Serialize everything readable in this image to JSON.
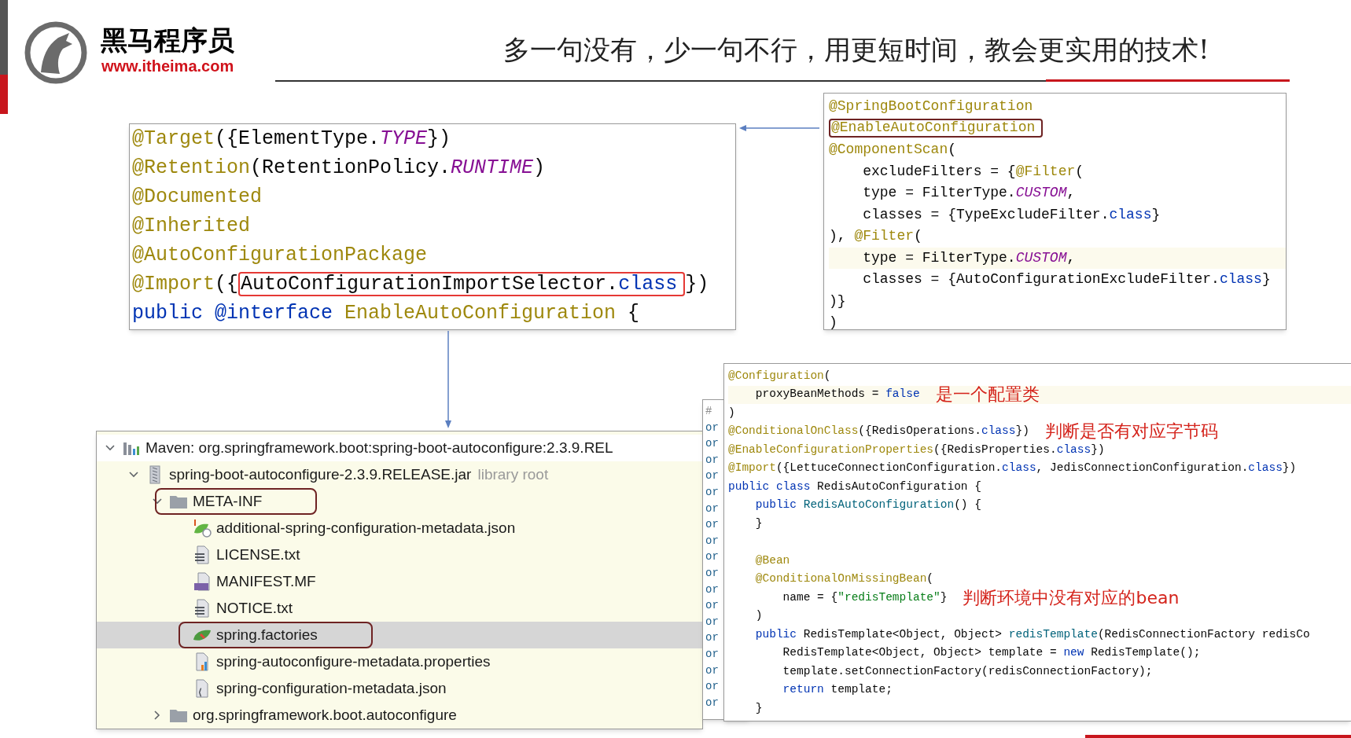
{
  "header": {
    "brand": "黑马程序员",
    "url": "www.itheima.com",
    "slogan": "多一句没有，少一句不行，用更短时间，教会更实用的技术!"
  },
  "annotation_source": {
    "lines": [
      {
        "tokens": [
          {
            "text": "@Target",
            "kind": "ann"
          },
          {
            "text": "({ElementType.",
            "kind": "p"
          },
          {
            "text": "TYPE",
            "kind": "const"
          },
          {
            "text": "})",
            "kind": "p"
          }
        ]
      },
      {
        "tokens": [
          {
            "text": "@Retention",
            "kind": "ann"
          },
          {
            "text": "(RetentionPolicy.",
            "kind": "p"
          },
          {
            "text": "RUNTIME",
            "kind": "const"
          },
          {
            "text": ")",
            "kind": "p"
          }
        ]
      },
      {
        "tokens": [
          {
            "text": "@Documented",
            "kind": "ann"
          }
        ]
      },
      {
        "tokens": [
          {
            "text": "@Inherited",
            "kind": "ann"
          }
        ]
      },
      {
        "tokens": [
          {
            "text": "@AutoConfigurationPackage",
            "kind": "ann"
          }
        ]
      },
      {
        "tokens": [
          {
            "text": "@Import",
            "kind": "ann"
          },
          {
            "text": "({",
            "kind": "p"
          },
          {
            "kind": "box",
            "color": "#e53935",
            "tokens": [
              {
                "text": "AutoConfigurationImportSelector.",
                "kind": "p"
              },
              {
                "text": "class",
                "kind": "kw"
              }
            ]
          },
          {
            "text": "})",
            "kind": "p"
          }
        ]
      },
      {
        "tokens": [
          {
            "text": "public @interface",
            "kind": "kw"
          },
          {
            "text": " EnableAutoConfiguration",
            "kind": "ann"
          },
          {
            "text": " {",
            "kind": "p"
          }
        ]
      }
    ]
  },
  "application_source": {
    "lines": [
      {
        "tokens": [
          {
            "text": "@SpringBootConfiguration",
            "kind": "ann"
          }
        ]
      },
      {
        "tokens": [
          {
            "kind": "box",
            "color": "#6e2323",
            "tokens": [
              {
                "text": "@EnableAutoConfiguration",
                "kind": "ann"
              }
            ]
          }
        ]
      },
      {
        "tokens": [
          {
            "text": "@ComponentScan",
            "kind": "ann"
          },
          {
            "text": "(",
            "kind": "p"
          }
        ]
      },
      {
        "tokens": [
          {
            "text": "    excludeFilters = {",
            "kind": "p"
          },
          {
            "text": "@Filter",
            "kind": "ann"
          },
          {
            "text": "(",
            "kind": "p"
          }
        ]
      },
      {
        "tokens": [
          {
            "text": "    type = FilterType.",
            "kind": "p"
          },
          {
            "text": "CUSTOM",
            "kind": "const"
          },
          {
            "text": ",",
            "kind": "p"
          }
        ]
      },
      {
        "tokens": [
          {
            "text": "    classes = {TypeExcludeFilter.",
            "kind": "p"
          },
          {
            "text": "class",
            "kind": "kw"
          },
          {
            "text": "}",
            "kind": "p"
          }
        ]
      },
      {
        "tokens": [
          {
            "text": "), ",
            "kind": "p"
          },
          {
            "text": "@Filter",
            "kind": "ann"
          },
          {
            "text": "(",
            "kind": "p"
          }
        ]
      },
      {
        "current": true,
        "tokens": [
          {
            "text": "    type = FilterType.",
            "kind": "p"
          },
          {
            "text": "CUSTOM",
            "kind": "const"
          },
          {
            "text": ",",
            "kind": "p"
          }
        ]
      },
      {
        "tokens": [
          {
            "text": "    classes = {AutoConfigurationExcludeFilter.",
            "kind": "p"
          },
          {
            "text": "class",
            "kind": "kw"
          },
          {
            "text": "}",
            "kind": "p"
          }
        ]
      },
      {
        "tokens": [
          {
            "text": ")}",
            "kind": "p"
          }
        ]
      },
      {
        "tokens": [
          {
            "text": ")",
            "kind": "p"
          }
        ]
      }
    ]
  },
  "project_tree": {
    "items": [
      {
        "kind": "library",
        "label": "Maven: org.springframework.boot:spring-boot-autoconfigure:2.3.9.REL",
        "expanded": true,
        "selected": false,
        "children": [
          {
            "kind": "jar",
            "label": "spring-boot-autoconfigure-2.3.9.RELEASE.jar",
            "hint": "library root",
            "expanded": true,
            "selected": false,
            "children": [
              {
                "kind": "folder",
                "label": "META-INF",
                "expanded": true,
                "selected": false,
                "highlighted": true,
                "children": [
                  {
                    "kind": "spring-meta",
                    "label": "additional-spring-configuration-metadata.json",
                    "selected": false
                  },
                  {
                    "kind": "text",
                    "label": "LICENSE.txt",
                    "selected": false
                  },
                  {
                    "kind": "manifest",
                    "label": "MANIFEST.MF",
                    "selected": false
                  },
                  {
                    "kind": "text",
                    "label": "NOTICE.txt",
                    "selected": false
                  },
                  {
                    "kind": "spring",
                    "label": "spring.factories",
                    "selected": true,
                    "highlighted": true
                  },
                  {
                    "kind": "properties",
                    "label": "spring-autoconfigure-metadata.properties",
                    "selected": false
                  },
                  {
                    "kind": "json",
                    "label": "spring-configuration-metadata.json",
                    "selected": false
                  }
                ]
              },
              {
                "kind": "folder",
                "label": "org.springframework.boot.autoconfigure",
                "expanded": false,
                "selected": false
              }
            ]
          }
        ]
      }
    ]
  },
  "factories_strip": {
    "lines": [
      "#",
      "or",
      "or",
      "or",
      "or",
      "or",
      "or",
      "or",
      "or",
      "or",
      "or",
      "or",
      "or",
      "or",
      "or",
      "or",
      "or",
      "or",
      "or"
    ]
  },
  "redis_source": {
    "lines": [
      {
        "tokens": [
          {
            "text": "@Configuration",
            "kind": "ann"
          },
          {
            "text": "(",
            "kind": "p"
          }
        ]
      },
      {
        "current": true,
        "tokens": [
          {
            "text": "    proxyBeanMethods = ",
            "kind": "p"
          },
          {
            "text": "false",
            "kind": "kw"
          }
        ],
        "note": "是一个配置类"
      },
      {
        "tokens": [
          {
            "text": ")",
            "kind": "p"
          }
        ]
      },
      {
        "tokens": [
          {
            "text": "@ConditionalOnClass",
            "kind": "ann"
          },
          {
            "text": "({RedisOperations.",
            "kind": "p"
          },
          {
            "text": "class",
            "kind": "kw"
          },
          {
            "text": "})",
            "kind": "p"
          }
        ],
        "note": "判断是否有对应字节码"
      },
      {
        "tokens": [
          {
            "text": "@EnableConfigurationProperties",
            "kind": "ann"
          },
          {
            "text": "({RedisProperties.",
            "kind": "p"
          },
          {
            "text": "class",
            "kind": "kw"
          },
          {
            "text": "})",
            "kind": "p"
          }
        ]
      },
      {
        "tokens": [
          {
            "text": "@Import",
            "kind": "ann"
          },
          {
            "text": "({LettuceConnectionConfiguration.",
            "kind": "p"
          },
          {
            "text": "class",
            "kind": "kw"
          },
          {
            "text": ", JedisConnectionConfiguration.",
            "kind": "p"
          },
          {
            "text": "class",
            "kind": "kw"
          },
          {
            "text": "})",
            "kind": "p"
          }
        ]
      },
      {
        "tokens": [
          {
            "text": "public class",
            "kind": "kw"
          },
          {
            "text": " RedisAutoConfiguration {",
            "kind": "p"
          }
        ]
      },
      {
        "tokens": [
          {
            "text": "    public",
            "kind": "kw"
          },
          {
            "text": " RedisAutoConfiguration",
            "kind": "fn"
          },
          {
            "text": "() {",
            "kind": "p"
          }
        ]
      },
      {
        "tokens": [
          {
            "text": "    }",
            "kind": "p"
          }
        ]
      },
      {
        "kind": "blank"
      },
      {
        "tokens": [
          {
            "text": "    @Bean",
            "kind": "ann"
          }
        ]
      },
      {
        "tokens": [
          {
            "text": "    @ConditionalOnMissingBean",
            "kind": "ann"
          },
          {
            "text": "(",
            "kind": "p"
          }
        ]
      },
      {
        "tokens": [
          {
            "text": "        name = {",
            "kind": "p"
          },
          {
            "text": "\"redisTemplate\"",
            "kind": "str"
          },
          {
            "text": "}",
            "kind": "p"
          }
        ],
        "note": "判断环境中没有对应的bean"
      },
      {
        "tokens": [
          {
            "text": "    )",
            "kind": "p"
          }
        ]
      },
      {
        "tokens": [
          {
            "text": "    public",
            "kind": "kw"
          },
          {
            "text": " RedisTemplate<Object, Object> ",
            "kind": "p"
          },
          {
            "text": "redisTemplate",
            "kind": "fn"
          },
          {
            "text": "(RedisConnectionFactory redisCo",
            "kind": "p"
          }
        ]
      },
      {
        "tokens": [
          {
            "text": "        RedisTemplate<Object, Object> template = ",
            "kind": "p"
          },
          {
            "text": "new",
            "kind": "kw"
          },
          {
            "text": " RedisTemplate();",
            "kind": "p"
          }
        ]
      },
      {
        "tokens": [
          {
            "text": "        template.setConnectionFactory(redisConnectionFactory);",
            "kind": "p"
          }
        ]
      },
      {
        "tokens": [
          {
            "text": "        return",
            "kind": "kw"
          },
          {
            "text": " template;",
            "kind": "p"
          }
        ]
      },
      {
        "tokens": [
          {
            "text": "    }",
            "kind": "p"
          }
        ]
      }
    ]
  }
}
